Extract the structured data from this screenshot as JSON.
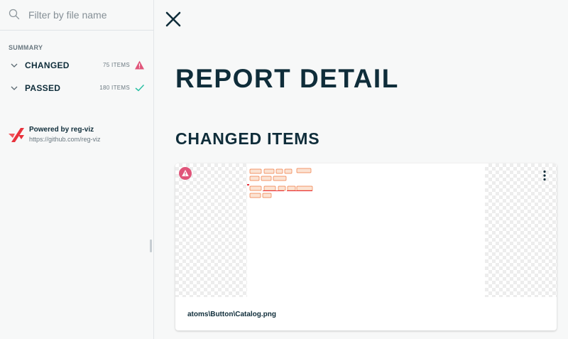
{
  "search": {
    "placeholder": "Filter by file name",
    "value": ""
  },
  "summary": {
    "label": "SUMMARY",
    "items": [
      {
        "name": "CHANGED",
        "count": "75 ITEMS",
        "status_icon": "warning-icon",
        "status_color": "#e0557a"
      },
      {
        "name": "PASSED",
        "count": "180 ITEMS",
        "status_icon": "check-icon",
        "status_color": "#2cc0a4"
      }
    ]
  },
  "powered": {
    "title": "Powered by reg-viz",
    "url": "https://github.com/reg-viz"
  },
  "main": {
    "title": "REPORT DETAIL",
    "section_title": "CHANGED ITEMS",
    "cards": [
      {
        "filename": "atoms\\Button\\Catalog.png",
        "status_icon": "warning-icon"
      }
    ]
  },
  "colors": {
    "text": "#0f2d3a",
    "muted": "#6a7880",
    "warning": "#e0557a",
    "success": "#2cc0a4",
    "brand": "#e8323c",
    "accent_orange": "#f07a42"
  }
}
